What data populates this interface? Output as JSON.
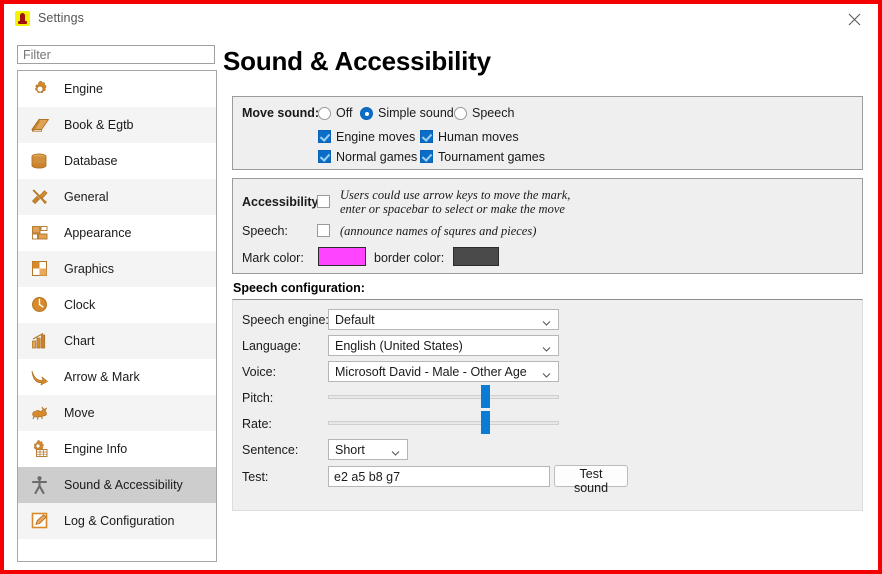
{
  "window": {
    "title": "Settings",
    "app_icon": "chess-pawn-icon",
    "close_label": "×",
    "border_color": "#f50000"
  },
  "sidebar": {
    "filter_placeholder": "Filter",
    "filter_value": "",
    "items": [
      {
        "label": "Engine",
        "icon": "gear-icon",
        "selected": false
      },
      {
        "label": "Book & Egtb",
        "icon": "book-icon",
        "selected": false
      },
      {
        "label": "Database",
        "icon": "database-icon",
        "selected": false
      },
      {
        "label": "General",
        "icon": "tools-icon",
        "selected": false
      },
      {
        "label": "Appearance",
        "icon": "layout-icon",
        "selected": false
      },
      {
        "label": "Graphics",
        "icon": "checker-icon",
        "selected": false
      },
      {
        "label": "Clock",
        "icon": "clock-icon",
        "selected": false
      },
      {
        "label": "Chart",
        "icon": "bar-chart-icon",
        "selected": false
      },
      {
        "label": "Arrow & Mark",
        "icon": "arrow-icon",
        "selected": false
      },
      {
        "label": "Move",
        "icon": "rabbit-icon",
        "selected": false
      },
      {
        "label": "Engine Info",
        "icon": "gear-grid-icon",
        "selected": false
      },
      {
        "label": "Sound & Accessibility",
        "icon": "accessibility-icon",
        "selected": true
      },
      {
        "label": "Log & Configuration",
        "icon": "edit-note-icon",
        "selected": false
      }
    ]
  },
  "page": {
    "title": "Sound & Accessibility"
  },
  "move_sound": {
    "label": "Move sound:",
    "options": [
      {
        "label": "Off",
        "selected": false
      },
      {
        "label": "Simple sound",
        "selected": true
      },
      {
        "label": "Speech",
        "selected": false
      }
    ],
    "checkboxes": [
      {
        "label": "Engine moves",
        "checked": true
      },
      {
        "label": "Human moves",
        "checked": true
      },
      {
        "label": "Normal games",
        "checked": true
      },
      {
        "label": "Tournament games",
        "checked": true
      }
    ]
  },
  "accessibility": {
    "label": "Accessibility:",
    "checked": false,
    "hint_line1": "Users could use arrow keys to move the mark,",
    "hint_line2": "enter or spacebar to select or make the move",
    "speech_label": "Speech:",
    "speech_checked": false,
    "speech_hint": "(announce names of squres and pieces)",
    "mark_color_label": "Mark color:",
    "mark_color": "#ff44ff",
    "border_color_label": "border color:",
    "border_color": "#4a4a4a"
  },
  "speech_config": {
    "heading": "Speech configuration:",
    "engine_label": "Speech engine:",
    "engine_value": "Default",
    "language_label": "Language:",
    "language_value": "English (United States)",
    "voice_label": "Voice:",
    "voice_value": "Microsoft David - Male - Other Age",
    "pitch_label": "Pitch:",
    "pitch_percent": 68,
    "rate_label": "Rate:",
    "rate_percent": 68,
    "sentence_label": "Sentence:",
    "sentence_value": "Short",
    "test_label": "Test:",
    "test_value": "e2 a5 b8 g7",
    "test_button": "Test sound"
  }
}
